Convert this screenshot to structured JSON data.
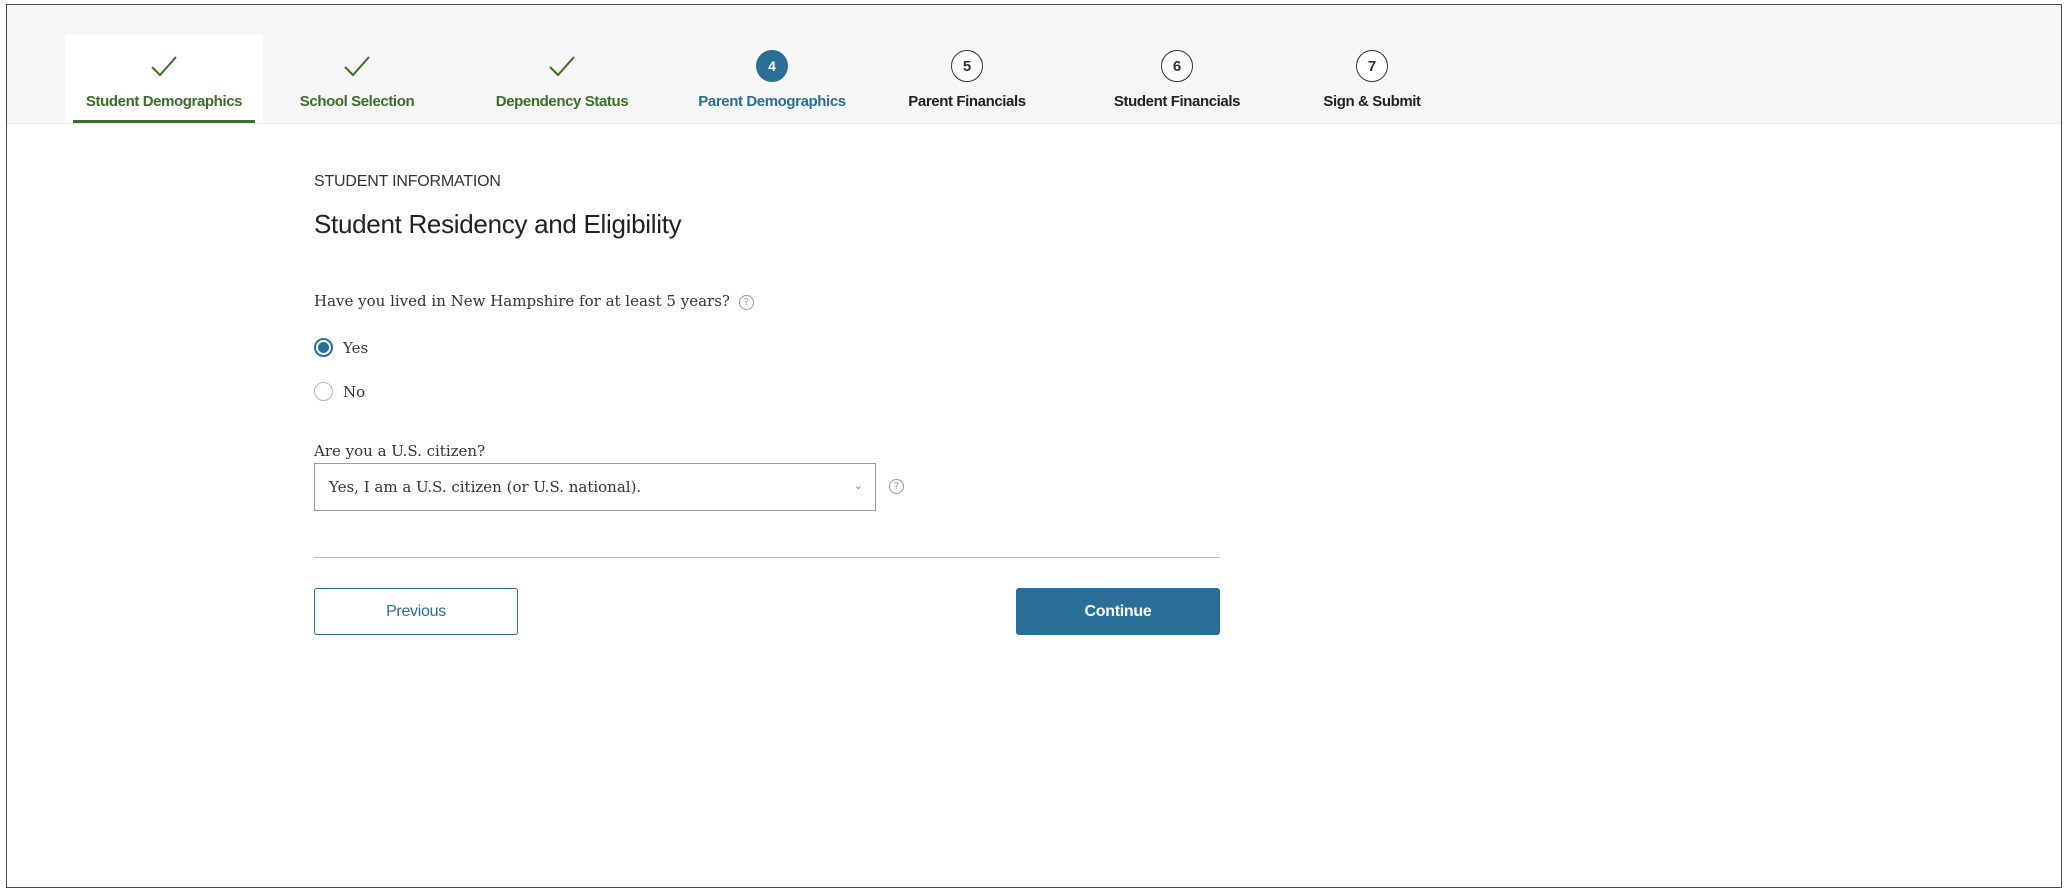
{
  "stepper": {
    "steps": [
      {
        "number": "1",
        "label": "Student Demographics",
        "state": "complete",
        "icon": "check-icon"
      },
      {
        "number": "2",
        "label": "School Selection",
        "state": "complete",
        "icon": "check-icon"
      },
      {
        "number": "3",
        "label": "Dependency Status",
        "state": "complete",
        "icon": "check-icon"
      },
      {
        "number": "4",
        "label": "Parent Demographics",
        "state": "current"
      },
      {
        "number": "5",
        "label": "Parent Financials",
        "state": "upcoming"
      },
      {
        "number": "6",
        "label": "Student Financials",
        "state": "upcoming"
      },
      {
        "number": "7",
        "label": "Sign & Submit",
        "state": "upcoming"
      }
    ]
  },
  "form": {
    "eyebrow": "STUDENT INFORMATION",
    "title": "Student Residency and Eligibility",
    "residency_question": "Have you lived in New Hampshire for at least 5 years?",
    "residency_options": [
      "Yes",
      "No"
    ],
    "residency_selected": "Yes",
    "citizen_question": "Are you a U.S. citizen?",
    "citizen_selected": "Yes, I am a U.S. citizen (or U.S. national).",
    "help_glyph": "?"
  },
  "actions": {
    "previous_label": "Previous",
    "continue_label": "Continue"
  },
  "colors": {
    "complete": "#3c6e2a",
    "accent": "#2a6f97",
    "stepper_bg": "#f6f6f6"
  }
}
